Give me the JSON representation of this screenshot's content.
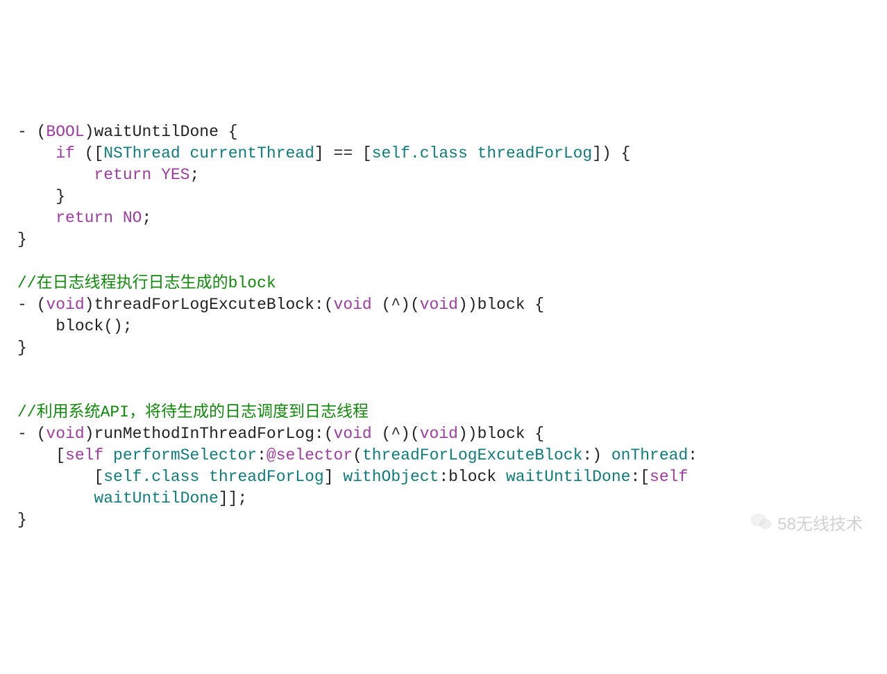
{
  "code": {
    "line1": {
      "dash": "- (",
      "type": "BOOL",
      "close": ")",
      "name": "waitUntilDone",
      "brace": " {"
    },
    "line2": {
      "indent": "    ",
      "if": "if",
      "open": " ([",
      "nsthread": "NSThread",
      "sp": " ",
      "currentThread": "currentThread",
      "mid": "] == [",
      "selfclass": "self.class",
      "sp2": " ",
      "threadForLog": "threadForLog",
      "close": "]) {"
    },
    "line3": {
      "indent": "        ",
      "return": "return",
      "sp": " ",
      "yes": "YES",
      "semi": ";"
    },
    "line4": {
      "indent": "    ",
      "brace": "}"
    },
    "line5": {
      "indent": "    ",
      "return": "return",
      "sp": " ",
      "no": "NO",
      "semi": ";"
    },
    "line6": {
      "brace": "}"
    },
    "line7": {
      "blank": ""
    },
    "line8": {
      "comment": "//在日志线程执行日志生成的block"
    },
    "line9": {
      "dash": "- (",
      "void1": "void",
      "close1": ")",
      "name": "threadForLogExcuteBlock",
      "colon": ":(",
      "void2": "void",
      "mid": " (^)(",
      "void3": "void",
      "close2": "))",
      "param": "block",
      "brace": " {"
    },
    "line10": {
      "indent": "    ",
      "call": "block();"
    },
    "line11": {
      "brace": "}"
    },
    "line12": {
      "blank": ""
    },
    "line13": {
      "blank": ""
    },
    "line14": {
      "comment": "//利用系统API，将待生成的日志调度到日志线程"
    },
    "line15": {
      "dash": "- (",
      "void1": "void",
      "close1": ")",
      "name": "runMethodInThreadForLog",
      "colon": ":(",
      "void2": "void",
      "mid": " (^)(",
      "void3": "void",
      "close2": "))",
      "param": "block",
      "brace": " {"
    },
    "line16": {
      "indent": "    [",
      "self": "self",
      "sp": " ",
      "performSelector": "performSelector",
      "colon": ":",
      "at": "@selector",
      "open": "(",
      "sel": "threadForLogExcuteBlock",
      "selc": ":) ",
      "onThread": "onThread",
      "colon2": ":"
    },
    "line17": {
      "indent": "        [",
      "selfclass": "self.class",
      "sp": " ",
      "threadForLog": "threadForLog",
      "close": "] ",
      "withObject": "withObject",
      "colon": ":",
      "block": "block ",
      "waitUntilDone": "waitUntilDone",
      "colon2": ":[",
      "self": "self"
    },
    "line18": {
      "indent": "        ",
      "waitUntilDone": "waitUntilDone",
      "close": "]];"
    },
    "line19": {
      "brace": "}"
    }
  },
  "watermark": {
    "text": "58无线技术"
  }
}
